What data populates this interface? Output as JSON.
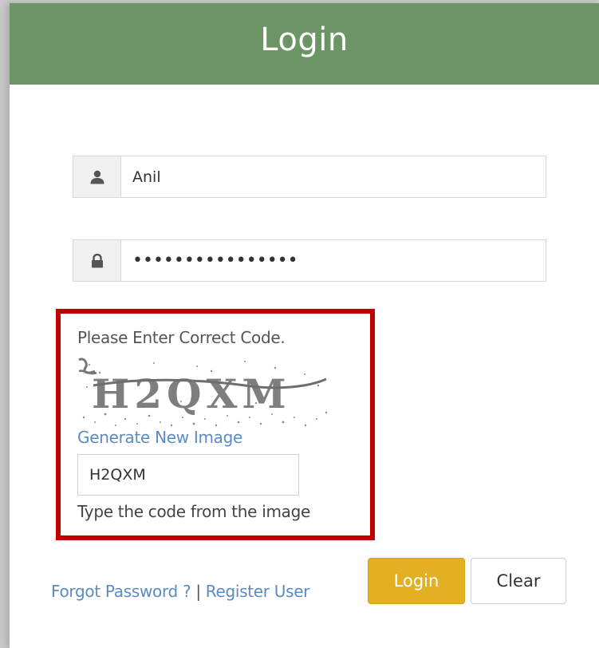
{
  "header": {
    "title": "Login"
  },
  "username": {
    "value": "Anil",
    "icon": "user-icon"
  },
  "password": {
    "value": "••••••••••••••••",
    "icon": "lock-icon"
  },
  "captcha": {
    "message": "Please Enter Correct Code.",
    "image_text": "H2QXM",
    "regenerate_link": "Generate New Image",
    "input_value": "H2QXM",
    "hint": "Type the code from the image",
    "highlight_color": "#c00000"
  },
  "footer": {
    "forgot_link": "Forgot Password ?",
    "separator": "|",
    "register_link": "Register User"
  },
  "buttons": {
    "login": "Login",
    "clear": "Clear"
  },
  "colors": {
    "header": "#6c9565",
    "login_button": "#e3b023",
    "link": "#5b8bc3"
  }
}
